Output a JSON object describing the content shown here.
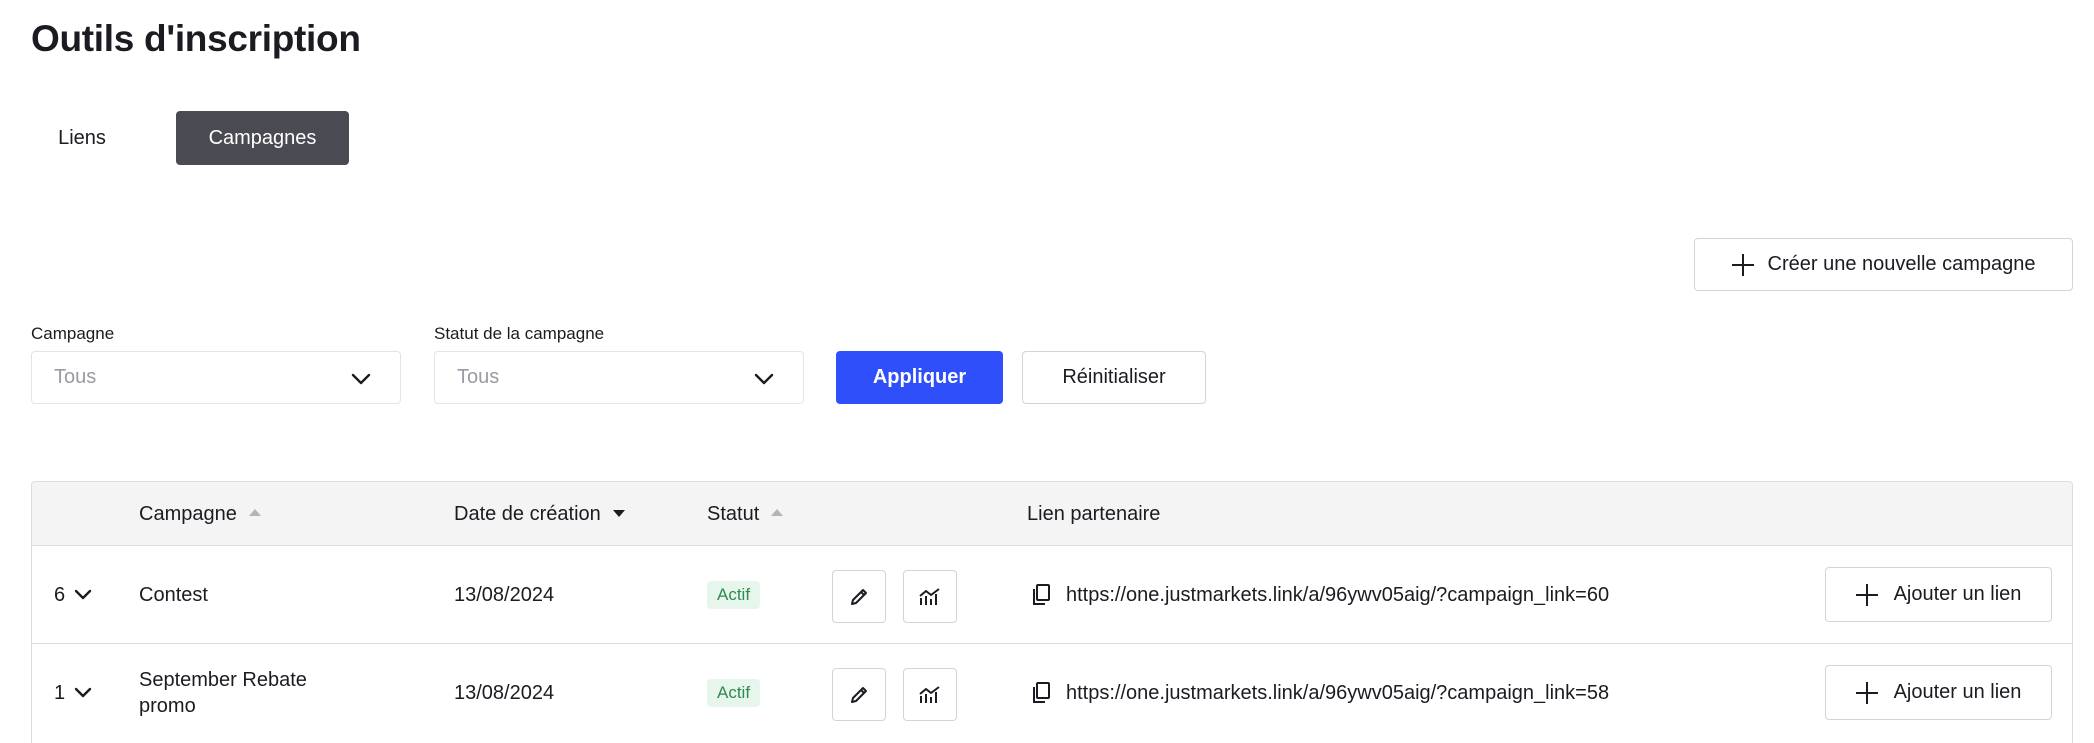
{
  "page": {
    "title": "Outils d'inscription"
  },
  "tabs": [
    {
      "label": "Liens",
      "active": false
    },
    {
      "label": "Campagnes",
      "active": true
    }
  ],
  "actions": {
    "create_campaign": "Créer une nouvelle campagne"
  },
  "filters": {
    "campaign": {
      "label": "Campagne",
      "value": "Tous"
    },
    "status": {
      "label": "Statut de la campagne",
      "value": "Tous"
    },
    "apply": "Appliquer",
    "reset": "Réinitialiser"
  },
  "table": {
    "columns": {
      "campaign": "Campagne",
      "created": "Date de création",
      "status": "Statut",
      "partner_link": "Lien partenaire"
    },
    "rows": [
      {
        "count": "6",
        "name": "Contest",
        "date": "13/08/2024",
        "status": "Actif",
        "link": "https://one.justmarkets.link/a/96ywv05aig/?campaign_link=60",
        "add_link": "Ajouter un lien"
      },
      {
        "count": "1",
        "name": "September Rebate promo",
        "date": "13/08/2024",
        "status": "Actif",
        "link": "https://one.justmarkets.link/a/96ywv05aig/?campaign_link=58",
        "add_link": "Ajouter un lien"
      }
    ]
  },
  "colors": {
    "primary": "#2f4ffa",
    "tab_active": "#4a4a52",
    "badge_bg": "#e7f6ec",
    "badge_text": "#2f8a4d"
  }
}
